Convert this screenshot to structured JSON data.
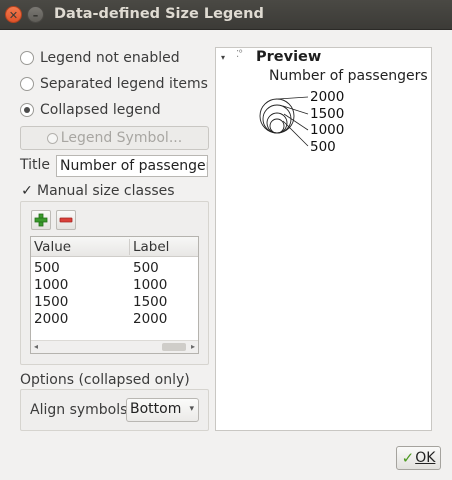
{
  "window": {
    "title": "Data-defined Size Legend",
    "close_glyph": "✕",
    "minimize_glyph": "–"
  },
  "legend_mode": {
    "options": [
      {
        "label": "Legend not enabled",
        "checked": false
      },
      {
        "label": "Separated legend items",
        "checked": false
      },
      {
        "label": "Collapsed legend",
        "checked": true
      }
    ]
  },
  "legend_symbol_button": {
    "label": "Legend Symbol..."
  },
  "title_field": {
    "label": "Title",
    "value": "Number of passengers"
  },
  "manual_classes": {
    "label": "Manual size classes",
    "checked": true,
    "check_glyph": "✓"
  },
  "toolbar": {
    "add_icon": "plus-icon",
    "remove_icon": "minus-icon"
  },
  "classes_table": {
    "columns": [
      "Value",
      "Label"
    ],
    "rows": [
      {
        "value": "500",
        "label": "500"
      },
      {
        "value": "1000",
        "label": "1000"
      },
      {
        "value": "1500",
        "label": "1500"
      },
      {
        "value": "2000",
        "label": "2000"
      }
    ],
    "scroll_left": "◂",
    "scroll_right": "▸"
  },
  "options": {
    "heading": "Options (collapsed only)",
    "align_label": "Align symbols",
    "align_value": "Bottom",
    "caret": "▾"
  },
  "preview": {
    "tree_arrow": "▾",
    "tree_icon": "⁚°",
    "title": "Preview",
    "legend_title": "Number of passengers",
    "labels": [
      "2000",
      "1500",
      "1000",
      "500"
    ]
  },
  "ok_button": {
    "check_glyph": "✓",
    "label": "OK"
  },
  "colors": {
    "ok_check": "#4c9a20",
    "add_icon": "#3a9a2c",
    "remove_icon": "#c9302c"
  }
}
